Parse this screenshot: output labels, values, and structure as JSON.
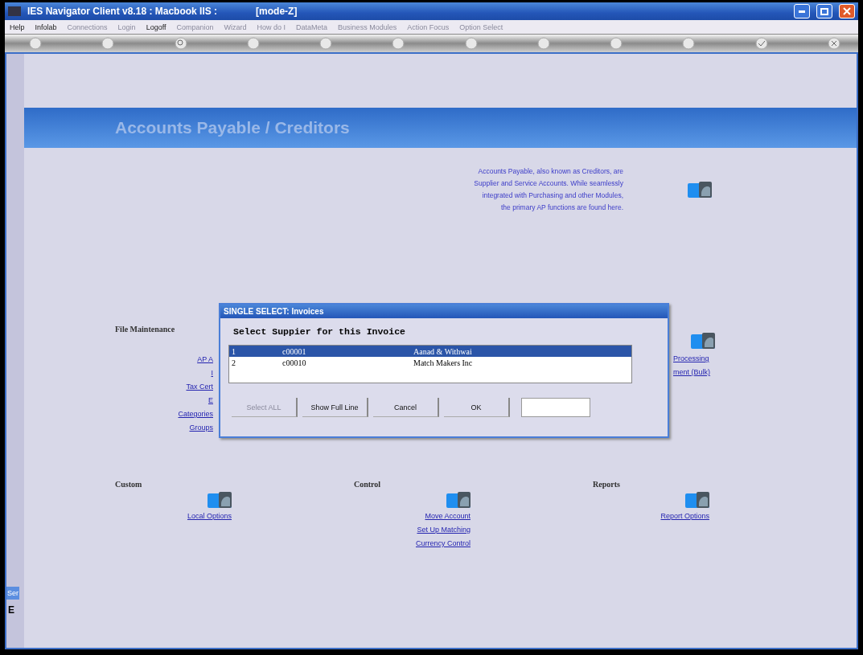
{
  "window": {
    "title": "IES Navigator Client v8.18 : Macbook IIS :",
    "mode": "[mode-Z]"
  },
  "menu": [
    {
      "label": "Help",
      "disabled": false
    },
    {
      "label": "Infolab",
      "disabled": false
    },
    {
      "label": "Connections",
      "disabled": true
    },
    {
      "label": "Login",
      "disabled": true
    },
    {
      "label": "Logoff",
      "disabled": false
    },
    {
      "label": "Companion",
      "disabled": true
    },
    {
      "label": "Wizard",
      "disabled": true
    },
    {
      "label": "How do I",
      "disabled": true
    },
    {
      "label": "DataMeta",
      "disabled": true
    },
    {
      "label": "Business Modules",
      "disabled": true
    },
    {
      "label": "Action Focus",
      "disabled": true
    },
    {
      "label": "Option Select",
      "disabled": true
    }
  ],
  "page": {
    "title": "Accounts Payable / Creditors",
    "description": [
      "Accounts Payable, also known as Creditors, are",
      "Supplier and Service Accounts. While seamlessly",
      "integrated with Purchasing and other Modules,",
      "the primary AP functions are found here."
    ]
  },
  "file_maintenance": {
    "heading": "File Maintenance",
    "links": [
      "AP A",
      "I",
      "Tax Cert",
      "E",
      "Categories",
      "Groups"
    ]
  },
  "processing": {
    "links": [
      "Processing",
      "ment (Bulk)"
    ]
  },
  "sections": [
    {
      "heading": "Custom",
      "links": [
        "Local Options"
      ]
    },
    {
      "heading": "Control",
      "links": [
        "Move Account",
        "Set Up Matching",
        "Currency Control"
      ]
    },
    {
      "heading": "Reports",
      "links": [
        "Report Options"
      ]
    }
  ],
  "side_tab": {
    "label": "Ser",
    "letter": "E"
  },
  "dialog": {
    "title": "SINGLE SELECT: Invoices",
    "prompt": "Select Suppier for this Invoice",
    "rows": [
      {
        "no": "1",
        "code": "c00001",
        "name": "Aanad & Withwai",
        "selected": true
      },
      {
        "no": "2",
        "code": "c00010",
        "name": "Match Makers Inc",
        "selected": false
      }
    ],
    "buttons": [
      {
        "label": "Select ALL",
        "disabled": true
      },
      {
        "label": "Show Full Line",
        "disabled": false
      },
      {
        "label": "Cancel",
        "disabled": false
      },
      {
        "label": "OK",
        "disabled": false
      }
    ]
  }
}
